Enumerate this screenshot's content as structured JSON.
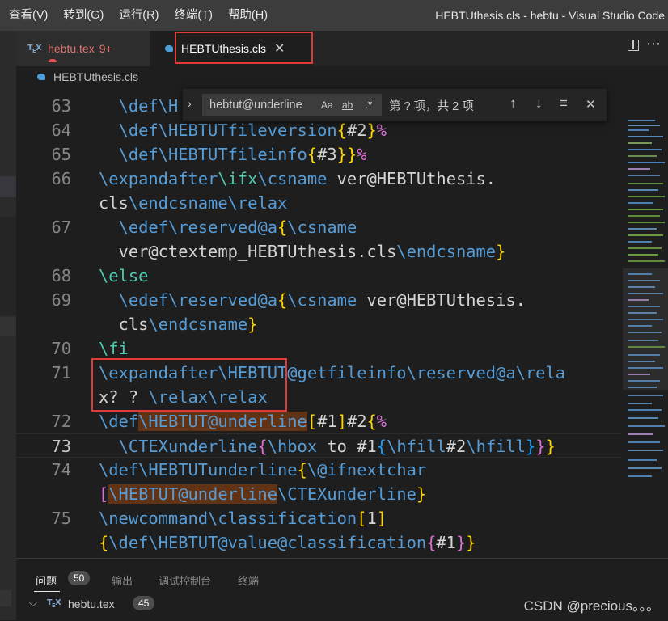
{
  "menu": [
    "查看(V)",
    "转到(G)",
    "运行(R)",
    "终端(T)",
    "帮助(H)"
  ],
  "window_title": "HEBTUthesis.cls - hebtu - Visual Studio Code",
  "tabs": [
    {
      "label": "hebtu.tex",
      "problems": "9+",
      "icon": "tex-icon"
    },
    {
      "label": "HEBTUthesis.cls",
      "close": "✕",
      "icon": "cls-icon",
      "active": true
    }
  ],
  "breadcrumb": "HEBTUthesis.cls",
  "find": {
    "query": "hebtut@underline",
    "match_case": "Aa",
    "whole_word": "ab",
    "regex": ".*",
    "result": "第 ? 项，共 2 项",
    "prev": "↑",
    "next": "↓",
    "selection": "≡",
    "close": "✕",
    "toggle": "›"
  },
  "editor": {
    "current_line": "73",
    "line_numbers": [
      "63",
      "64",
      "65",
      "66",
      "",
      "67",
      "",
      "68",
      "69",
      "",
      "70",
      "71",
      "",
      "72",
      "73",
      "74",
      "",
      "75",
      ""
    ]
  },
  "panel": {
    "tabs": [
      "问题",
      "输出",
      "调试控制台",
      "终端"
    ],
    "problems_count": "50",
    "file": "hebtu.tex",
    "file_count": "45"
  },
  "watermark": "CSDN @precious。。。",
  "colors": {
    "accent_highlight": "#e23a3a",
    "keyword": "#569cd6",
    "bracket": "#ffd700",
    "match": "#613214"
  }
}
